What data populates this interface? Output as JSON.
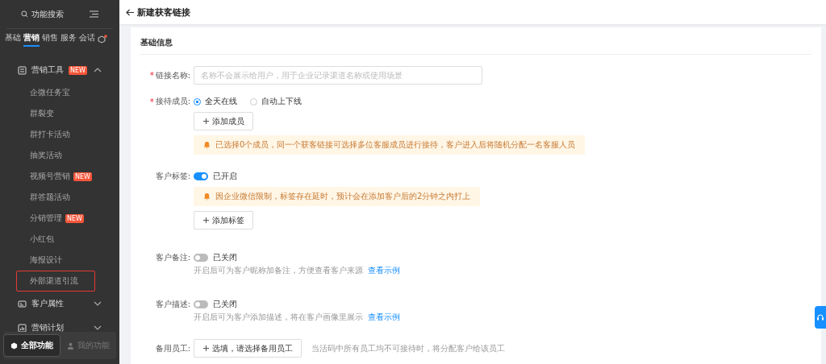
{
  "sidebar": {
    "search_placeholder": "功能搜索",
    "tabs": [
      {
        "label": "基础",
        "selected": false
      },
      {
        "label": "营销",
        "selected": true
      },
      {
        "label": "销售",
        "selected": false
      },
      {
        "label": "服务",
        "selected": false
      },
      {
        "label": "会话",
        "selected": false
      }
    ],
    "tab_settings_dot": true,
    "menu": [
      {
        "label": "营销工具",
        "badge": "NEW",
        "expanded": true,
        "children": [
          {
            "label": "企微任务宝",
            "highlighted": false
          },
          {
            "label": "群裂变",
            "highlighted": false
          },
          {
            "label": "群打卡活动",
            "highlighted": false
          },
          {
            "label": "抽奖活动",
            "highlighted": false
          },
          {
            "label": "视频号营销",
            "badge": "NEW",
            "highlighted": false
          },
          {
            "label": "群答题活动",
            "highlighted": false
          },
          {
            "label": "分销管理",
            "badge": "NEW",
            "highlighted": false
          },
          {
            "label": "小红包",
            "highlighted": false
          },
          {
            "label": "海报设计",
            "highlighted": false
          },
          {
            "label": "外部渠道引流",
            "highlighted": true
          }
        ]
      },
      {
        "label": "客户属性",
        "expanded": false
      },
      {
        "label": "营销计划",
        "expanded": false
      }
    ],
    "bottom": [
      {
        "label": "全部功能",
        "selected": true
      },
      {
        "label": "我的功能",
        "selected": false
      }
    ]
  },
  "header": {
    "title": "新建获客链接"
  },
  "section_title": "基础信息",
  "fields": [
    {
      "kind": "input",
      "label": "链接名称:",
      "required_mark": "*",
      "placeholder": "名称不会展示给用户，用于企业记录渠道名称或使用场景"
    },
    {
      "kind": "radio",
      "label": "接待成员:",
      "required_mark": "*",
      "options": [
        {
          "label": "全天在线",
          "selected": true
        },
        {
          "label": "自动上下线",
          "selected": false
        }
      ],
      "button": "添加成员",
      "alert": "已选择0个成员，同一个获客链接可选择多位客服成员进行接待，客户进入后将随机分配一名客服人员"
    },
    {
      "kind": "toggle",
      "label": "客户标签:",
      "on": true,
      "state_text": "已开启",
      "alert": "因企业微信限制，标签存在延时，预计会在添加客户后的2分钟之内打上",
      "button": "添加标签"
    },
    {
      "kind": "toggle",
      "label": "客户备注:",
      "on": false,
      "state_text": "已关闭",
      "hint": "开启后可为客户昵称加备注，方便查看客户来源",
      "link": "查看示例"
    },
    {
      "kind": "toggle",
      "label": "客户描述:",
      "on": false,
      "state_text": "已关闭",
      "hint": "开启后可为客户添加描述，将在客户画像里展示",
      "link": "查看示例"
    },
    {
      "kind": "select",
      "label": "备用员工:",
      "button": "选填，请选择备用员工",
      "side_hint": "当活码中所有员工均不可接待时，将分配客户给该员工"
    }
  ]
}
